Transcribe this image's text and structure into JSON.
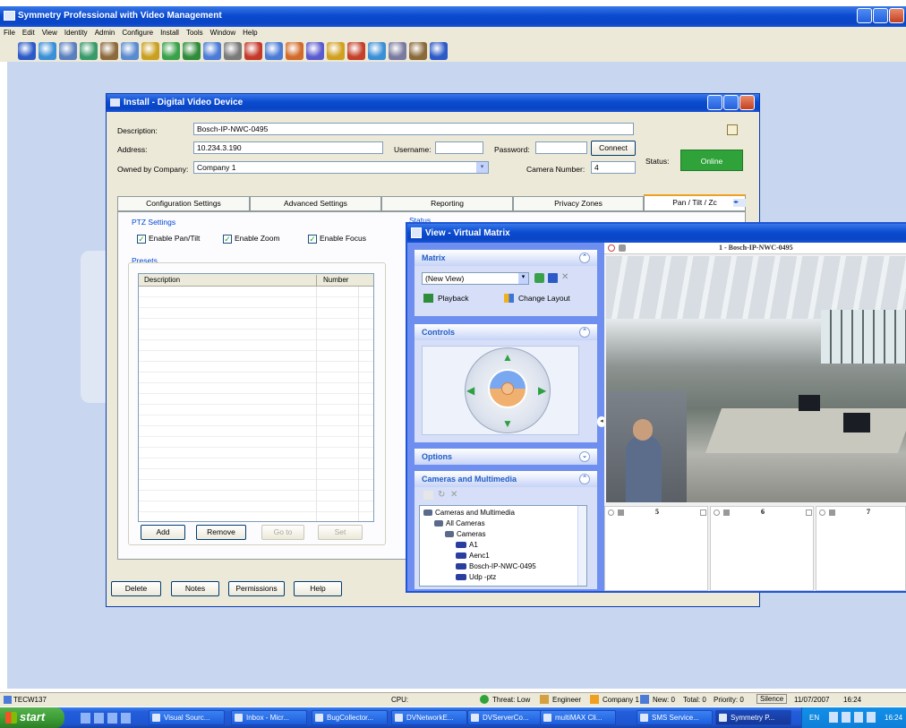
{
  "app": {
    "title": "Symmetry Professional with Video Management",
    "menu": [
      "File",
      "Edit",
      "View",
      "Identity",
      "Admin",
      "Configure",
      "Install",
      "Tools",
      "Window",
      "Help"
    ],
    "toolbar_icons": [
      "person-icon",
      "view-icon",
      "list-icon",
      "camera-icon",
      "network-icon",
      "disk-icon",
      "record-icon",
      "globe-icon",
      "map-icon",
      "video-icon",
      "clock-icon",
      "help-globe-icon",
      "grid-icon",
      "alarm-icon",
      "pen-icon",
      "warning-icon",
      "key-icon",
      "chart-icon",
      "refresh-icon",
      "report-icon",
      "help-icon"
    ]
  },
  "install_dialog": {
    "title": "Install - Digital Video Device",
    "description_label": "Description:",
    "description_value": "Bosch-IP-NWC-0495",
    "address_label": "Address:",
    "address_value": "10.234.3.190",
    "username_label": "Username:",
    "username_value": "",
    "password_label": "Password:",
    "password_value": "",
    "connect_label": "Connect",
    "owned_label": "Owned by Company:",
    "owned_value": "Company 1",
    "camera_number_label": "Camera Number:",
    "camera_number_value": "4",
    "status_label": "Status:",
    "status_value": "Online",
    "tabs": [
      "Configuration Settings",
      "Advanced Settings",
      "Reporting",
      "Privacy Zones",
      "Pan / Tilt / Zc"
    ],
    "ptz_settings_label": "PTZ Settings",
    "enable_pan_tilt": "Enable Pan/Tilt",
    "enable_zoom": "Enable Zoom",
    "enable_focus": "Enable Focus",
    "status_group_label": "Status",
    "presets_label": "Presets",
    "presets_columns": [
      "Description",
      "Number"
    ],
    "add_label": "Add",
    "remove_label": "Remove",
    "goto_label": "Go to",
    "set_label": "Set",
    "delete_label": "Delete",
    "notes_label": "Notes",
    "permissions_label": "Permissions",
    "help_label": "Help"
  },
  "virtual_matrix": {
    "title": "View - Virtual Matrix",
    "matrix_header": "Matrix",
    "view_select": "(New View)",
    "playback_label": "Playback",
    "change_layout_label": "Change Layout",
    "controls_header": "Controls",
    "options_header": "Options",
    "cameras_header": "Cameras and Multimedia",
    "tree": [
      {
        "label": "Cameras and Multimedia",
        "depth": 0
      },
      {
        "label": "All Cameras",
        "depth": 1
      },
      {
        "label": "Cameras",
        "depth": 2
      },
      {
        "label": "A1",
        "depth": 3
      },
      {
        "label": "Aenc1",
        "depth": 3
      },
      {
        "label": "Bosch-IP-NWC-0495",
        "depth": 3
      },
      {
        "label": "Udp -ptz",
        "depth": 3
      }
    ],
    "main_camera_title": "1 - Bosch-IP-NWC-0495",
    "tile_numbers": [
      "5",
      "6",
      "7"
    ]
  },
  "statusbar": {
    "machine": "TECW137",
    "cpu_label": "CPU:",
    "threat": "Threat: Low",
    "user": "Engineer",
    "company": "Company 1",
    "new": "New: 0",
    "total": "Total: 0",
    "priority": "Priority: 0",
    "silence": "Silence",
    "date": "11/07/2007",
    "time": "16:24"
  },
  "taskbar": {
    "start": "start",
    "tasks": [
      "Visual Sourc...",
      "Inbox - Micr...",
      "BugCollector...",
      "DVNetworkE...",
      "DVServerCo...",
      "multiMAX Cli...",
      "SMS Service...",
      "Symmetry P..."
    ],
    "lang": "EN",
    "clock": "16:24"
  },
  "colors": {
    "xp_blue": "#0a4bd0",
    "online_green": "#2fa33a",
    "desktop": "#c8d6ef"
  }
}
